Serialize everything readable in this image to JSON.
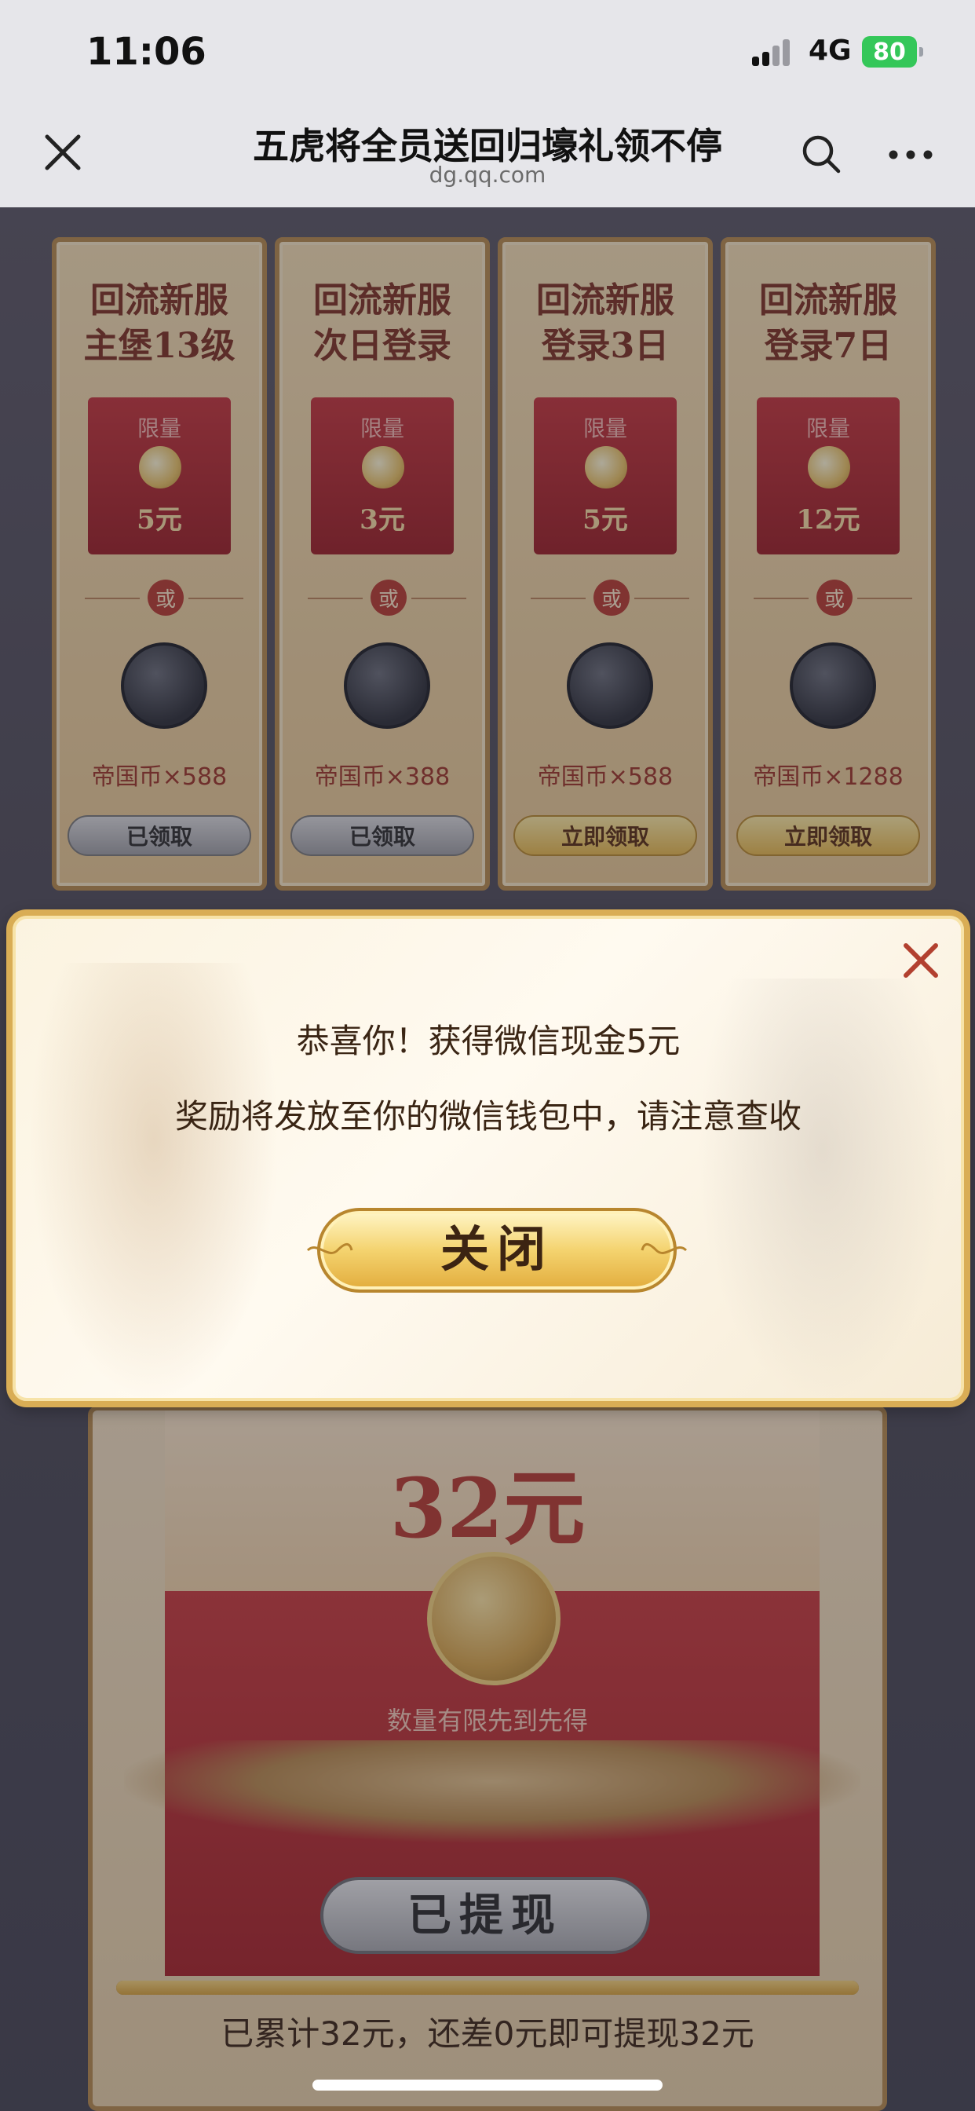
{
  "status_bar": {
    "time": "11:06",
    "network": "4G",
    "battery": "80"
  },
  "nav": {
    "title": "五虎将全员送回归壕礼领不停",
    "subtitle": "dg.qq.com"
  },
  "reward_cards": [
    {
      "title_line1": "回流新服",
      "title_line2": "主堡13级",
      "limit": "限量",
      "amount": "5元",
      "or_label": "或",
      "token": "帝国币×588",
      "button": "已领取",
      "state": "claimed"
    },
    {
      "title_line1": "回流新服",
      "title_line2": "次日登录",
      "limit": "限量",
      "amount": "3元",
      "or_label": "或",
      "token": "帝国币×388",
      "button": "已领取",
      "state": "claimed"
    },
    {
      "title_line1": "回流新服",
      "title_line2": "登录3日",
      "limit": "限量",
      "amount": "5元",
      "or_label": "或",
      "token": "帝国币×588",
      "button": "立即领取",
      "state": "active"
    },
    {
      "title_line1": "回流新服",
      "title_line2": "登录7日",
      "limit": "限量",
      "amount": "12元",
      "or_label": "或",
      "token": "帝国币×1288",
      "button": "立即领取",
      "state": "active"
    }
  ],
  "modal": {
    "line1": "恭喜你！获得微信现金5元",
    "line2": "奖励将发放至你的微信钱包中，请注意查收",
    "button": "关闭"
  },
  "cash_panel": {
    "amount": "32元",
    "limited_text": "数量有限先到先得",
    "withdrawn_button": "已提现",
    "progress_fraction": 1.0,
    "summary": "已累计32元，还差0元即可提现32元"
  },
  "colors": {
    "accent_gold": "#d9ad55",
    "packet_red": "#b73a2f",
    "battery_green": "#34c759"
  }
}
